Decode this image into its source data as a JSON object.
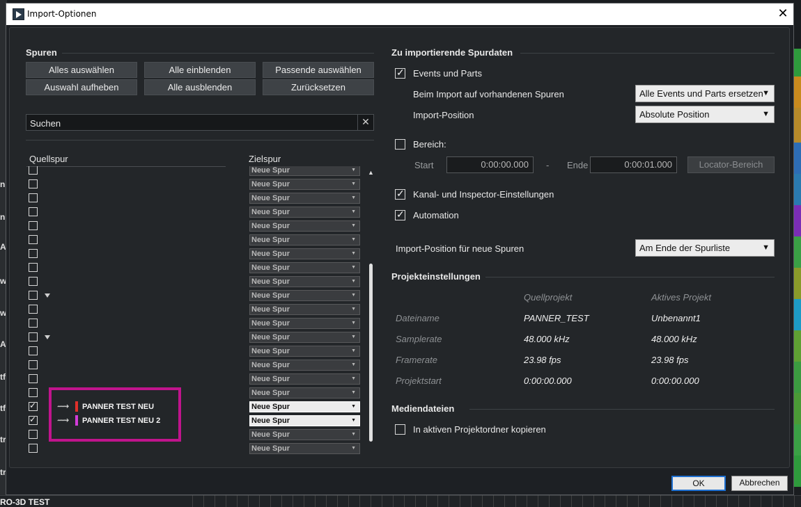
{
  "background": {
    "left_fragments": [
      "n",
      "n",
      "A",
      "w",
      "w",
      "A",
      "tf",
      "tf",
      "tr",
      "tr"
    ],
    "bottom_label": "RO-3D TEST"
  },
  "window": {
    "title": "Import-Optionen",
    "close_icon": "close-icon"
  },
  "spuren": {
    "title": "Spuren",
    "buttons": {
      "select_all": "Alles auswählen",
      "deselect": "Auswahl aufheben",
      "show_all": "Alle einblenden",
      "hide_all": "Alle ausblenden",
      "select_matching": "Passende auswählen",
      "reset": "Zurücksetzen"
    },
    "search": {
      "value": "Suchen"
    },
    "columns": {
      "source": "Quellspur",
      "target": "Zielspur"
    },
    "dropdown_default": "Neue Spur",
    "tracks": [
      {
        "checked": false,
        "folder": false,
        "name": "",
        "target": "Neue Spur"
      },
      {
        "checked": false,
        "folder": false,
        "name": "",
        "target": "Neue Spur"
      },
      {
        "checked": false,
        "folder": false,
        "name": "",
        "target": "Neue Spur"
      },
      {
        "checked": false,
        "folder": false,
        "name": "",
        "target": "Neue Spur"
      },
      {
        "checked": false,
        "folder": false,
        "name": "",
        "target": "Neue Spur"
      },
      {
        "checked": false,
        "folder": false,
        "name": "",
        "target": "Neue Spur"
      },
      {
        "checked": false,
        "folder": false,
        "name": "",
        "target": "Neue Spur"
      },
      {
        "checked": false,
        "folder": false,
        "name": "",
        "target": "Neue Spur"
      },
      {
        "checked": false,
        "folder": false,
        "name": "",
        "target": "Neue Spur"
      },
      {
        "checked": false,
        "folder": true,
        "name": "",
        "target": "Neue Spur"
      },
      {
        "checked": false,
        "folder": false,
        "name": "",
        "target": "Neue Spur"
      },
      {
        "checked": false,
        "folder": false,
        "name": "",
        "target": "Neue Spur"
      },
      {
        "checked": false,
        "folder": true,
        "name": "",
        "target": "Neue Spur"
      },
      {
        "checked": false,
        "folder": false,
        "name": "",
        "target": "Neue Spur"
      },
      {
        "checked": false,
        "folder": false,
        "name": "",
        "target": "Neue Spur"
      },
      {
        "checked": false,
        "folder": false,
        "name": "",
        "target": "Neue Spur"
      },
      {
        "checked": false,
        "folder": false,
        "name": "",
        "target": "Neue Spur"
      },
      {
        "checked": true,
        "folder": false,
        "name": "PANNER TEST NEU",
        "color": "#e0302a",
        "target": "Neue Spur"
      },
      {
        "checked": true,
        "folder": false,
        "name": "PANNER TEST NEU 2",
        "color": "#d13cd8",
        "target": "Neue Spur"
      },
      {
        "checked": false,
        "folder": false,
        "name": "",
        "target": "Neue Spur"
      },
      {
        "checked": false,
        "folder": false,
        "name": "",
        "target": "Neue Spur"
      }
    ]
  },
  "spurdaten": {
    "title": "Zu importierende Spurdaten",
    "events_parts": {
      "label": "Events und Parts",
      "checked": true
    },
    "existing_tracks": {
      "label": "Beim Import auf vorhandenen Spuren",
      "value": "Alle Events und Parts ersetzen"
    },
    "import_position": {
      "label": "Import-Position",
      "value": "Absolute Position"
    },
    "range": {
      "label": "Bereich:",
      "checked": false,
      "start_label": "Start",
      "start": "0:00:00.000",
      "dash": "-",
      "end_label": "Ende",
      "end": "0:00:01.000",
      "locator_button": "Locator-Bereich"
    },
    "channel_settings": {
      "label": "Kanal- und Inspector-Einstellungen",
      "checked": true
    },
    "automation": {
      "label": "Automation",
      "checked": true
    },
    "new_track_position": {
      "label": "Import-Position für neue Spuren",
      "value": "Am Ende der Spurliste"
    }
  },
  "projekt": {
    "title": "Projekteinstellungen",
    "col_source": "Quellprojekt",
    "col_active": "Aktives Projekt",
    "rows": [
      {
        "key": "Dateiname",
        "source": "PANNER_TEST",
        "active": "Unbenannt1"
      },
      {
        "key": "Samplerate",
        "source": "48.000 kHz",
        "active": "48.000 kHz"
      },
      {
        "key": "Framerate",
        "source": "23.98 fps",
        "active": "23.98 fps"
      },
      {
        "key": "Projektstart",
        "source": "0:00:00.000",
        "active": "0:00:00.000"
      }
    ]
  },
  "medien": {
    "title": "Mediendateien",
    "copy": {
      "label": "In aktiven Projektordner kopieren",
      "checked": false
    }
  },
  "footer": {
    "ok": "OK",
    "cancel": "Abbrechen"
  },
  "colors": {
    "highlight": "#c0148c",
    "ok_focus": "#1e6fd0"
  }
}
